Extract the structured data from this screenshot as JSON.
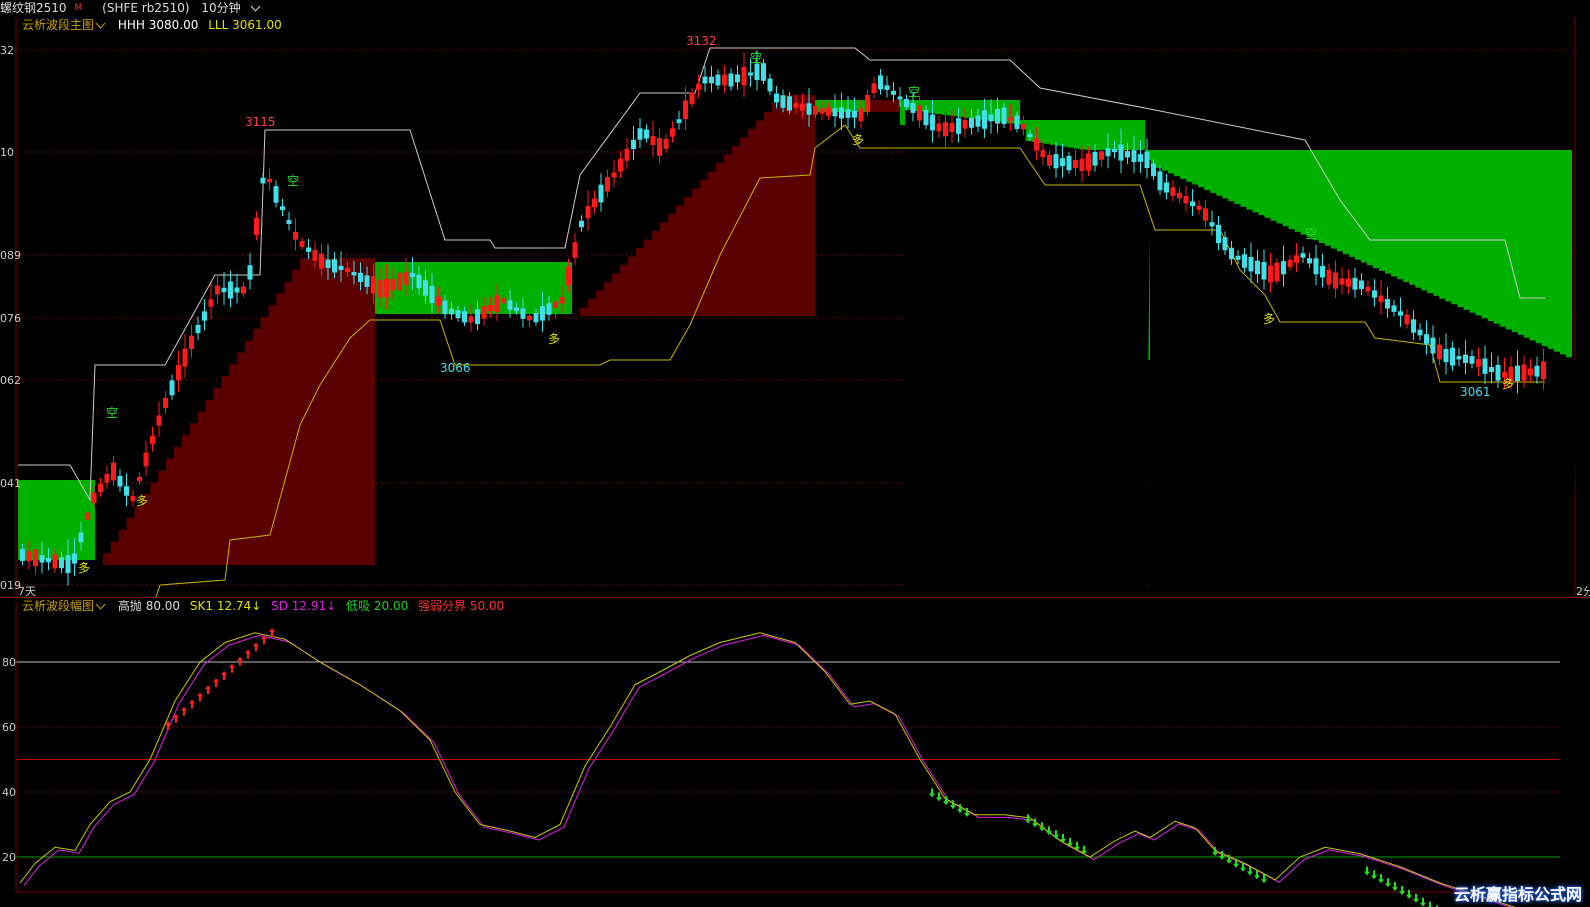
{
  "header": {
    "symbol": "螺纹钢2510",
    "superscript": "M",
    "code": "(SHFE rb2510)",
    "period": "10分钟"
  },
  "main_legend": {
    "name": "云析波段主图",
    "hhh_label": "HHH",
    "hhh_value": "3080.00",
    "lll_label": "LLL",
    "lll_value": "3061.00"
  },
  "sub_legend": {
    "name": "云析波段幅图",
    "high_label": "高抛",
    "high_value": "80.00",
    "sk1_label": "SK1",
    "sk1_value": "12.74",
    "sd_label": "SD",
    "sd_value": "12.91",
    "low_label": "低吸",
    "low_value": "20.00",
    "mid_label": "强弱分界",
    "mid_value": "50.00"
  },
  "colors": {
    "bull": "#ff1a1a",
    "bear": "#3fe0e8",
    "green_zone": "#00b000",
    "red_zone": "#5a0000",
    "sk1": "#c8c800",
    "sd": "#e020e0"
  },
  "main_axis": {
    "labels": [
      "32",
      "10",
      "089",
      "076",
      "062",
      "041",
      "019"
    ],
    "left_note": "7天",
    "right_note": "2分"
  },
  "sub_axis": {
    "labels": [
      "80",
      "60",
      "40",
      "20"
    ]
  },
  "annotations": {
    "peaks": [
      {
        "text": "3115",
        "kind": "high"
      },
      {
        "text": "3132",
        "kind": "high"
      },
      {
        "text": "3066",
        "kind": "low"
      },
      {
        "text": "3061",
        "kind": "low"
      }
    ],
    "kong": [
      "空",
      "空",
      "空",
      "空",
      "空"
    ],
    "duo": [
      "多",
      "多",
      "多",
      "多",
      "多",
      "多"
    ]
  },
  "brand": "云析赢指标公式网"
}
